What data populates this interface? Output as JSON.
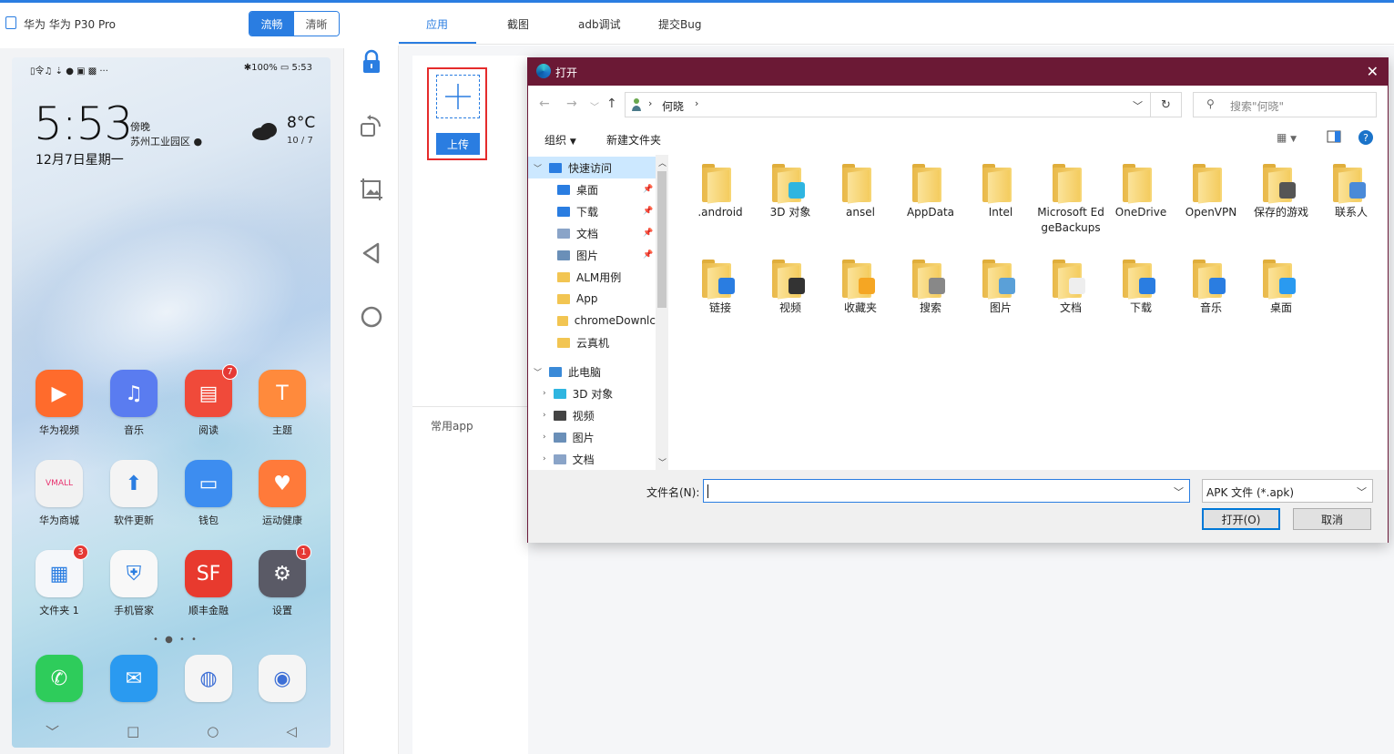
{
  "device": {
    "title": "华为 华为 P30 Pro",
    "mode_fluent": "流畅",
    "mode_clear": "清晰"
  },
  "phone": {
    "status_left": "▯令♫ ⇣ ● ▣ ▩ ···",
    "status_right": "✱100% ▭ 5:53",
    "time": "5:53",
    "location1": "傍晚",
    "location2": "苏州工业园区",
    "date": "12月7日星期一",
    "temp": "8°C",
    "temp_range": "10 / 7",
    "apps": [
      {
        "label": "华为视频",
        "color": "#ff6b2c",
        "glyph": "▶"
      },
      {
        "label": "音乐",
        "color": "#5a7cf0",
        "glyph": "♫"
      },
      {
        "label": "阅读",
        "color": "#f04a3a",
        "glyph": "▤",
        "badge": "7"
      },
      {
        "label": "主题",
        "color": "#ff8a3c",
        "glyph": "T"
      },
      {
        "label": "华为商城",
        "color": "#f2f2f2",
        "glyph": "VMALL"
      },
      {
        "label": "软件更新",
        "color": "#f4f4f4",
        "glyph": "⬆"
      },
      {
        "label": "钱包",
        "color": "#3d8df0",
        "glyph": "▭"
      },
      {
        "label": "运动健康",
        "color": "#ff7a3a",
        "glyph": "♥"
      },
      {
        "label": "文件夹 1",
        "color": "#f5f7fa",
        "glyph": "▦",
        "badge": "3"
      },
      {
        "label": "手机管家",
        "color": "#f8f8f8",
        "glyph": "⛨"
      },
      {
        "label": "顺丰金融",
        "color": "#e83a2e",
        "glyph": "SF"
      },
      {
        "label": "设置",
        "color": "#5a5a66",
        "glyph": "⚙",
        "badge": "1"
      }
    ],
    "dock": [
      {
        "name": "phone",
        "color": "#2ecc5b",
        "glyph": "✆"
      },
      {
        "name": "messages",
        "color": "#2a9af0",
        "glyph": "✉"
      },
      {
        "name": "browser",
        "color": "#f5f5f5",
        "glyph": "◍"
      },
      {
        "name": "camera",
        "color": "#f5f5f5",
        "glyph": "◉"
      }
    ],
    "dots": "• ● • •",
    "nav": [
      "﹀",
      "□",
      "○",
      "◁"
    ]
  },
  "tabs": [
    "应用",
    "截图",
    "adb调试",
    "提交Bug"
  ],
  "main": {
    "upload_label": "上传",
    "common_apps": "常用app"
  },
  "dialog": {
    "title": "打开",
    "path": "何晓",
    "search_placeholder": "搜索\"何晓\"",
    "organize": "组织",
    "new_folder": "新建文件夹",
    "tree": [
      {
        "label": "快速访问",
        "level": 0,
        "type": "star",
        "selected": true
      },
      {
        "label": "桌面",
        "level": 1,
        "type": "desktop",
        "pin": true
      },
      {
        "label": "下载",
        "level": 1,
        "type": "down",
        "pin": true
      },
      {
        "label": "文档",
        "level": 1,
        "type": "doc",
        "pin": true
      },
      {
        "label": "图片",
        "level": 1,
        "type": "pic",
        "pin": true
      },
      {
        "label": "ALM用例",
        "level": 1,
        "type": "folder"
      },
      {
        "label": "App",
        "level": 1,
        "type": "folder"
      },
      {
        "label": "chromeDownlc",
        "level": 1,
        "type": "folder"
      },
      {
        "label": "云真机",
        "level": 1,
        "type": "folder"
      },
      {
        "label": "此电脑",
        "level": 0,
        "type": "pc"
      },
      {
        "label": "3D 对象",
        "level": 1,
        "type": "cube"
      },
      {
        "label": "视频",
        "level": 1,
        "type": "video"
      },
      {
        "label": "图片",
        "level": 1,
        "type": "pic"
      },
      {
        "label": "文档",
        "level": 1,
        "type": "doc"
      }
    ],
    "files": [
      {
        "label": ".android",
        "overlay": ""
      },
      {
        "label": "3D 对象",
        "overlay": "#2fb5e0"
      },
      {
        "label": "ansel",
        "overlay": ""
      },
      {
        "label": "AppData",
        "overlay": ""
      },
      {
        "label": "Intel",
        "overlay": ""
      },
      {
        "label": "Microsoft EdgeBackups",
        "overlay": ""
      },
      {
        "label": "OneDrive",
        "overlay": ""
      },
      {
        "label": "OpenVPN",
        "overlay": ""
      },
      {
        "label": "保存的游戏",
        "overlay": "#555"
      },
      {
        "label": "联系人",
        "overlay": "#4a8ad8"
      },
      {
        "label": "链接",
        "overlay": "#2a7de1"
      },
      {
        "label": "视频",
        "overlay": "#333"
      },
      {
        "label": "收藏夹",
        "overlay": "#f5a623"
      },
      {
        "label": "搜索",
        "overlay": "#888"
      },
      {
        "label": "图片",
        "overlay": "#5aa0d8"
      },
      {
        "label": "文档",
        "overlay": "#eeeeee"
      },
      {
        "label": "下载",
        "overlay": "#2a7de1"
      },
      {
        "label": "音乐",
        "overlay": "#2a7de1"
      },
      {
        "label": "桌面",
        "overlay": "#2a9af0"
      }
    ],
    "filename_label": "文件名(N):",
    "filetype": "APK 文件 (*.apk)",
    "open_btn": "打开(O)",
    "cancel_btn": "取消"
  }
}
